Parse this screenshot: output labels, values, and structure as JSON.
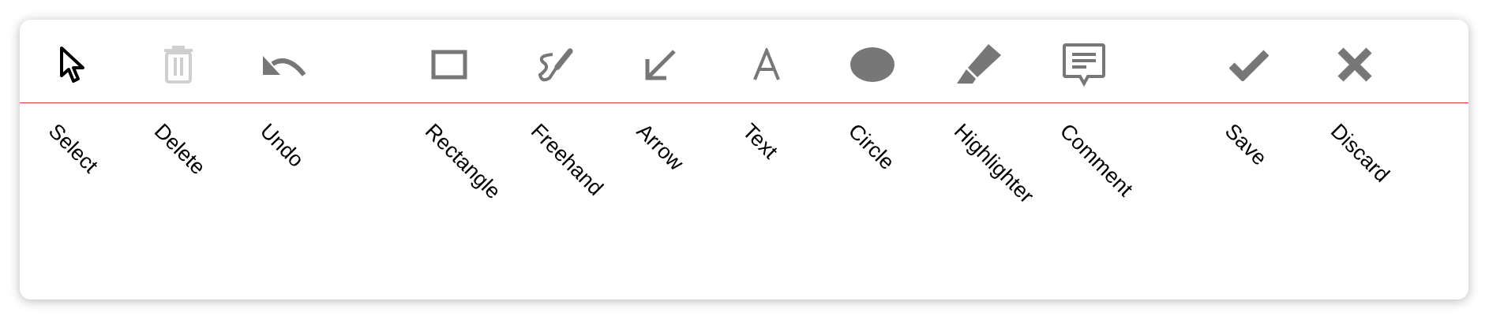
{
  "toolbar": {
    "groups": [
      {
        "tools": [
          {
            "label": "Select",
            "selected": true,
            "disabled": false
          },
          {
            "label": "Delete",
            "selected": false,
            "disabled": true
          },
          {
            "label": "Undo",
            "selected": false,
            "disabled": false
          }
        ]
      },
      {
        "tools": [
          {
            "label": "Rectangle",
            "selected": false,
            "disabled": false
          },
          {
            "label": "Freehand",
            "selected": false,
            "disabled": false
          },
          {
            "label": "Arrow",
            "selected": false,
            "disabled": false
          },
          {
            "label": "Text",
            "selected": false,
            "disabled": false
          },
          {
            "label": "Circle",
            "selected": false,
            "disabled": false
          },
          {
            "label": "Highlighter",
            "selected": false,
            "disabled": false
          },
          {
            "label": "Comment",
            "selected": false,
            "disabled": false
          }
        ]
      },
      {
        "tools": [
          {
            "label": "Save",
            "selected": false,
            "disabled": false
          },
          {
            "label": "Discard",
            "selected": false,
            "disabled": false
          }
        ]
      }
    ]
  }
}
